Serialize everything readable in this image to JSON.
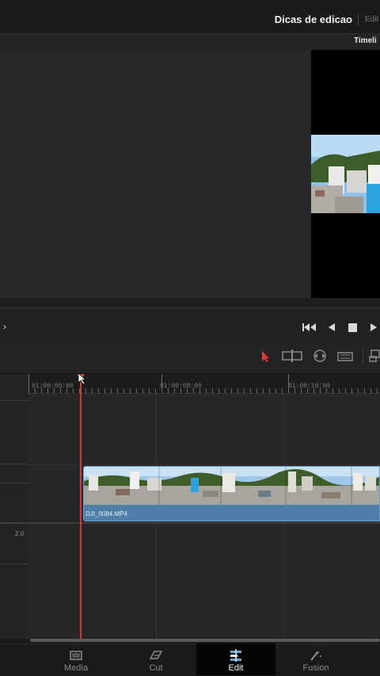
{
  "header": {
    "project_title": "Dicas de edicao",
    "page_crumb": "Edit",
    "panel_label": "Timeli"
  },
  "timeline": {
    "timecodes": [
      "01:00:00:00",
      "01:00:08:00",
      "01:00:16:00"
    ],
    "clip_name": "DJI_0084.MP4",
    "audio_level": "2.0"
  },
  "nav": {
    "tabs": [
      {
        "label": "Media",
        "icon": "media-icon"
      },
      {
        "label": "Cut",
        "icon": "cut-icon"
      },
      {
        "label": "Edit",
        "icon": "edit-icon",
        "active": true
      },
      {
        "label": "Fusion",
        "icon": "fusion-icon"
      }
    ]
  },
  "colors": {
    "playhead": "#e04646",
    "clip": "#4e7fa9",
    "active_tab": "#050505"
  }
}
